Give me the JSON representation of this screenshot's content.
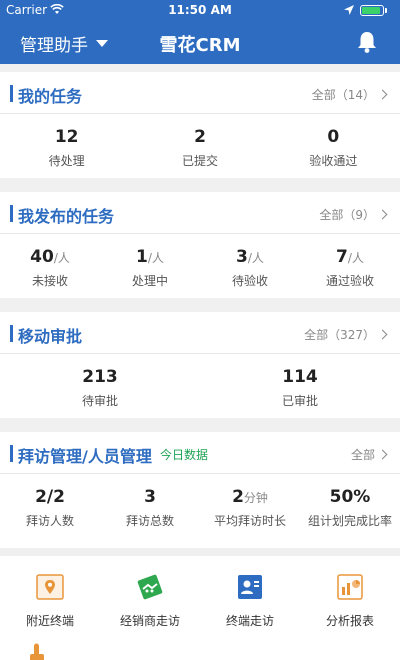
{
  "status_bar": {
    "carrier": "Carrier",
    "time": "11:50 AM",
    "battery_level": 0.9
  },
  "nav": {
    "menu_label": "管理助手",
    "title": "雪花CRM"
  },
  "my_tasks": {
    "title": "我的任务",
    "more": "全部（14）",
    "stats": [
      {
        "value": "12",
        "unit": "",
        "label": "待处理"
      },
      {
        "value": "2",
        "unit": "",
        "label": "已提交"
      },
      {
        "value": "0",
        "unit": "",
        "label": "验收通过"
      }
    ]
  },
  "published_tasks": {
    "title": "我发布的任务",
    "more": "全部（9）",
    "stats": [
      {
        "value": "40",
        "unit": "/人",
        "label": "未接收"
      },
      {
        "value": "1",
        "unit": "/人",
        "label": "处理中"
      },
      {
        "value": "3",
        "unit": "/人",
        "label": "待验收"
      },
      {
        "value": "7",
        "unit": "/人",
        "label": "通过验收"
      }
    ]
  },
  "approvals": {
    "title": "移动审批",
    "more": "全部（327）",
    "stats": [
      {
        "value": "213",
        "unit": "",
        "label": "待审批"
      },
      {
        "value": "114",
        "unit": "",
        "label": "已审批"
      }
    ]
  },
  "visits": {
    "title": "拜访管理/人员管理",
    "tag": "今日数据",
    "more": "全部",
    "stats": [
      {
        "value": "2/2",
        "unit": "",
        "label": "拜访人数"
      },
      {
        "value": "3",
        "unit": "",
        "label": "拜访总数"
      },
      {
        "value": "2",
        "unit": "分钟",
        "label": "平均拜访时长"
      },
      {
        "value": "50%",
        "unit": "",
        "label": "组计划完成比率"
      }
    ]
  },
  "shortcuts": [
    {
      "label": "附近终端",
      "icon": "map-pin-icon",
      "color": "#e8953a"
    },
    {
      "label": "经销商走访",
      "icon": "handshake-icon",
      "color": "#2ea84e"
    },
    {
      "label": "终端走访",
      "icon": "visit-card-icon",
      "color": "#2d6cc0"
    },
    {
      "label": "分析报表",
      "icon": "report-icon",
      "color": "#e8953a"
    }
  ],
  "colors": {
    "primary": "#2d6cc0",
    "accent_green": "#1fa354",
    "orange": "#e8953a"
  }
}
